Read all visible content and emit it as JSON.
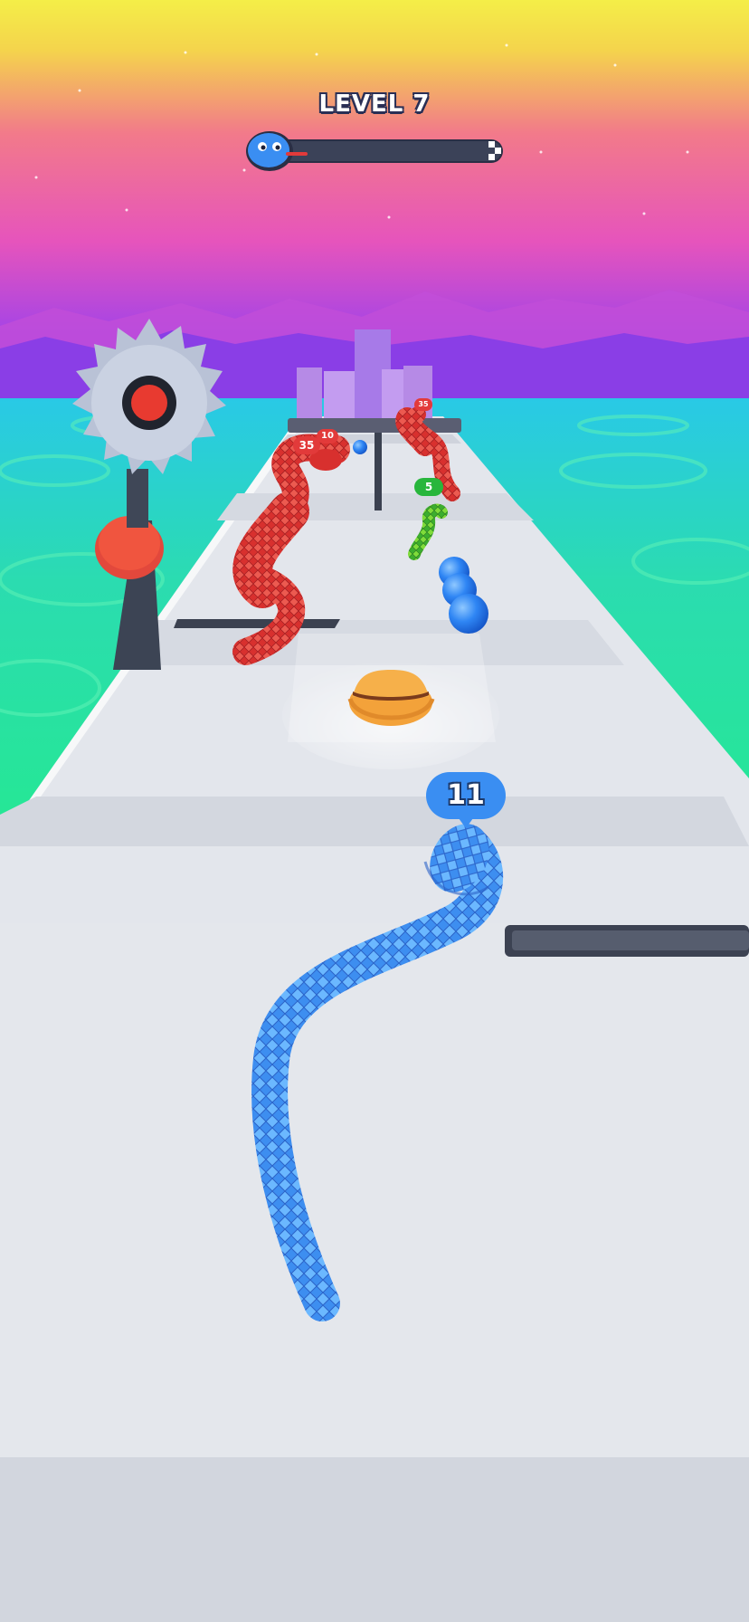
{
  "hud": {
    "level_label": "LEVEL 7",
    "progress": 0.0,
    "progress_icon": "snake-head-icon",
    "finish_icon": "checkered-flag-icon"
  },
  "player": {
    "length": "11",
    "color": "#3f8ff0"
  },
  "enemies": [
    {
      "name": "red-snake-near",
      "length": "35",
      "color": "#d83a3a"
    },
    {
      "name": "red-snake-small",
      "length": "10",
      "color": "#d83a3a"
    },
    {
      "name": "red-snake-far",
      "length": "35",
      "color": "#d83a3a"
    },
    {
      "name": "green-snake",
      "length": "5",
      "color": "#3fb83a"
    }
  ],
  "pickups": {
    "item": "cowboy-hat-icon",
    "orbs": "blue-orb"
  },
  "hazards": {
    "saw": "circular-saw-icon"
  },
  "colors": {
    "sky_top": "#f5ea48",
    "sky_mid": "#f07090",
    "sky_low": "#b040e0",
    "ground": "#27e890",
    "road": "#e6eaf0"
  }
}
